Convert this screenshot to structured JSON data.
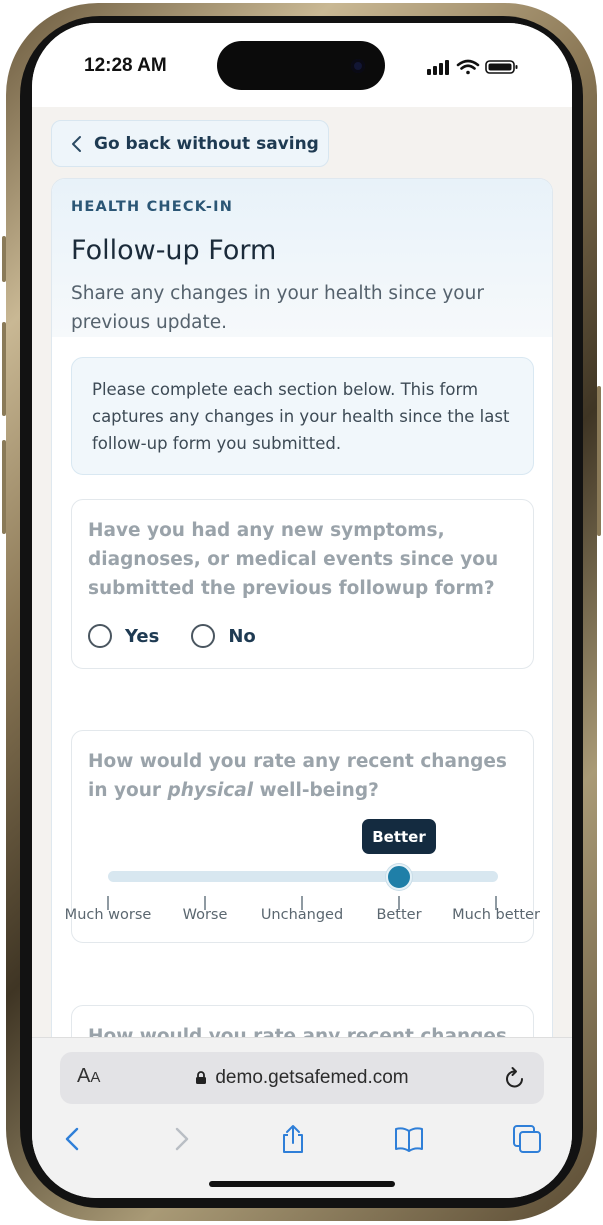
{
  "status_bar": {
    "time": "12:28 AM"
  },
  "back_button": {
    "label": "Go back without saving"
  },
  "form": {
    "eyebrow": "HEALTH CHECK-IN",
    "title": "Follow-up Form",
    "subtitle": "Share any changes in your health since your previous update.",
    "info": "Please complete each section below. This form captures any changes in your health since the last follow-up form you submitted."
  },
  "q1": {
    "question": "Have you had any new symptoms, diagnoses, or medical events since you submitted the previous followup form?",
    "options": [
      "Yes",
      "No"
    ]
  },
  "q2": {
    "question_before": "How would you rate any recent changes in your ",
    "question_emphasis": "physical",
    "question_after": " well-being?",
    "selected": "Better",
    "selected_index": 3,
    "labels": [
      "Much worse",
      "Worse",
      "Unchanged",
      "Better",
      "Much better"
    ]
  },
  "q3": {
    "question": "How would you rate any recent changes"
  },
  "browser": {
    "aa_label_big": "A",
    "aa_label_small": "A",
    "url": "demo.getsafemed.com"
  },
  "icons": [
    "chevron-left-icon",
    "lock-icon",
    "reload-icon",
    "back-icon",
    "forward-icon",
    "share-icon",
    "bookmarks-icon",
    "tabs-icon"
  ]
}
